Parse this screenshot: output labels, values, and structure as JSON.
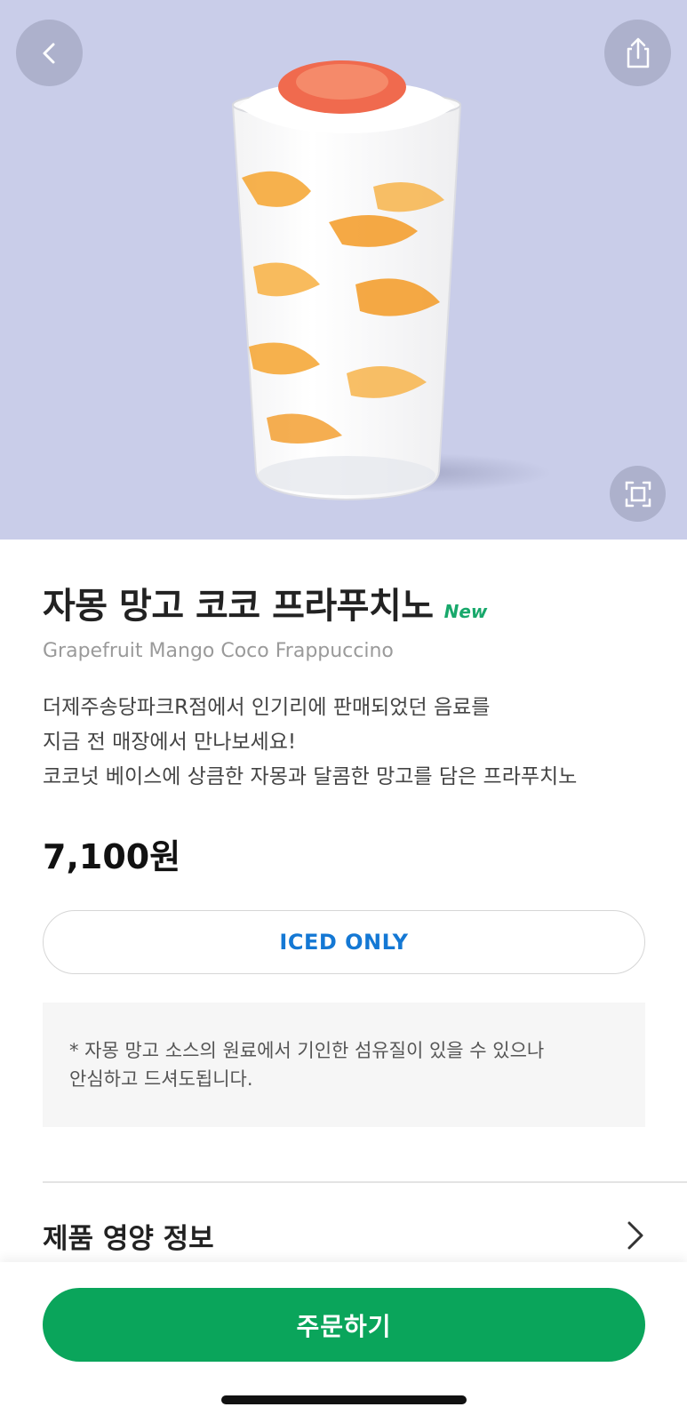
{
  "colors": {
    "hero_background": "#c9cde9",
    "brand_green": "#0aa55b",
    "new_badge": "#18a86b",
    "option_blue": "#1478d4"
  },
  "hero": {
    "image": "grapefruit-mango-coco-frappuccino-cup",
    "back_icon": "chevron-left-icon",
    "share_icon": "share-icon",
    "expand_icon": "expand-icon"
  },
  "product": {
    "name_ko": "자몽 망고 코코 프라푸치노",
    "badge": "New",
    "name_en": "Grapefruit Mango Coco Frappuccino",
    "description": [
      "더제주송당파크R점에서 인기리에 판매되었던 음료를",
      "지금 전 매장에서 만나보세요!",
      "코코넛 베이스에 상큼한 자몽과 달콤한 망고를 담은 프라푸치노"
    ],
    "price": "7,100원",
    "option": "ICED ONLY",
    "notice": [
      "* 자몽 망고 소스의 원료에서 기인한 섬유질이 있을 수 있으나",
      "안심하고 드셔도됩니다."
    ]
  },
  "nutrition": {
    "label": "제품 영양 정보",
    "icon": "chevron-right-icon"
  },
  "order": {
    "label": "주문하기"
  }
}
